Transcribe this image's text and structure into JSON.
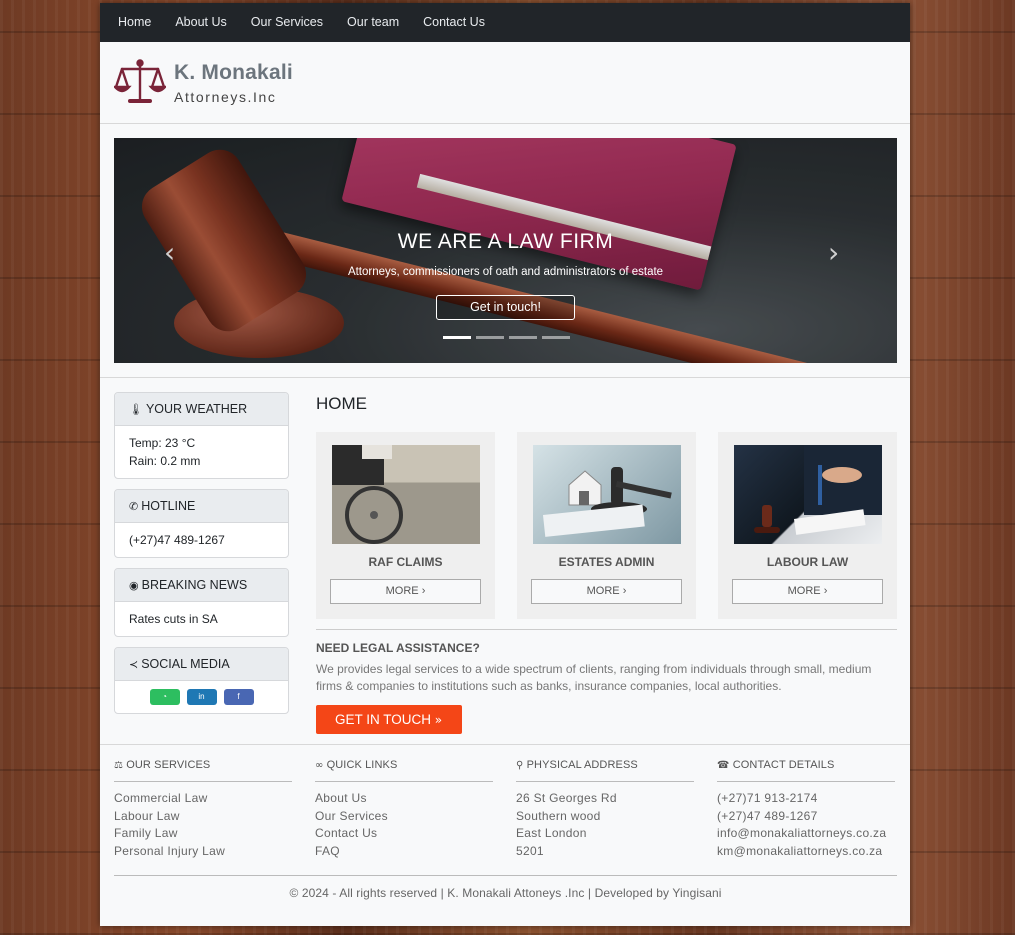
{
  "nav": {
    "items": [
      "Home",
      "About Us",
      "Our Services",
      "Our team",
      "Contact Us"
    ]
  },
  "brand": {
    "name": "K. Monakali",
    "subtitle": "Attorneys.Inc",
    "logo_icon": "scales-of-justice-icon"
  },
  "carousel": {
    "title": "WE ARE A LAW FIRM",
    "subtitle": "Attorneys, commissioners of oath and administrators of estate",
    "button": "Get in touch!",
    "prev_icon": "‹",
    "next_icon": "›",
    "slide_count": 4,
    "active_slide": 1
  },
  "sidebar": {
    "weather": {
      "title": "YOUR WEATHER",
      "icon": "thermometer-icon",
      "temp": "Temp: 23 °C",
      "rain": "Rain: 0.2 mm"
    },
    "hotline": {
      "title": "HOTLINE",
      "icon": "phone-icon",
      "number": "(+27)47 489-1267"
    },
    "news": {
      "title": "BREAKING NEWS",
      "icon": "rss-icon",
      "text": "Rates cuts in SA"
    },
    "social": {
      "title": "SOCIAL MEDIA",
      "icon": "share-icon",
      "whatsapp": "◔",
      "linkedin": "in",
      "facebook": "f",
      "colors": {
        "whatsapp": "#2dbe60",
        "linkedin": "#1f78b4",
        "facebook": "#4967b3"
      }
    }
  },
  "main": {
    "page_title": "HOME",
    "services": [
      {
        "title": "RAF CLAIMS",
        "more": "MORE"
      },
      {
        "title": "ESTATES ADMIN",
        "more": "MORE"
      },
      {
        "title": "LABOUR LAW",
        "more": "MORE"
      }
    ],
    "assistance": {
      "title": "NEED LEGAL ASSISTANCE?",
      "text": "We provides legal services to a wide spectrum of clients, ranging from individuals through small, medium firms & companies to institutions such as banks, insurance companies, local authorities.",
      "cta": "GET IN TOUCH"
    }
  },
  "footer": {
    "services": {
      "title": "OUR SERVICES",
      "items": [
        "Commercial Law",
        "Labour Law",
        "Family Law",
        "Personal Injury Law"
      ]
    },
    "links": {
      "title": "QUICK LINKS",
      "items": [
        "About Us",
        "Our Services",
        "Contact Us",
        "FAQ"
      ]
    },
    "address": {
      "title": "PHYSICAL ADDRESS",
      "items": [
        "26 St Georges Rd",
        "Southern wood",
        "East London",
        "5201"
      ]
    },
    "contact": {
      "title": "CONTACT DETAILS",
      "items": [
        "(+27)71 913-2174",
        "(+27)47 489-1267",
        "info@monakaliattorneys.co.za",
        "km@monakaliattorneys.co.za"
      ]
    },
    "copyright": "© 2024 - All rights reserved | K. Monakali Attoneys .Inc | Developed by Yingisani"
  },
  "colors": {
    "nav_bg": "#212529",
    "cta": "#f44617",
    "logo": "#7a2438"
  }
}
